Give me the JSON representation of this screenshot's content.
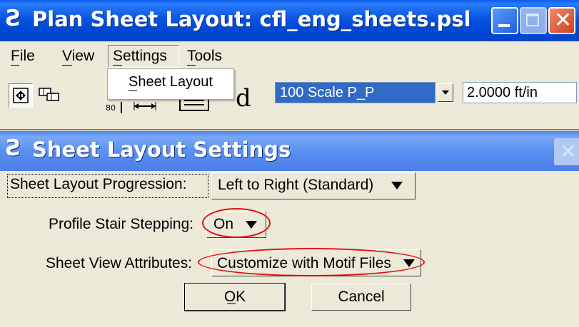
{
  "window1": {
    "title": "Plan Sheet Layout: cfl_eng_sheets.psl",
    "menu": [
      {
        "label": "File"
      },
      {
        "label": "View"
      },
      {
        "label": "Settings"
      },
      {
        "label": "Tools"
      }
    ],
    "settings_dropdown": {
      "item": "Sheet Layout"
    },
    "toolbar": {
      "scale_value": "100 Scale P_P",
      "ft_per_in": "2.0000 ft/in"
    }
  },
  "window2": {
    "title": "Sheet Layout Settings",
    "fields": {
      "progression_label": "Sheet Layout Progression:",
      "progression_value": "Left to Right (Standard)",
      "stair_label": "Profile Stair Stepping:",
      "stair_value": "On",
      "attributes_label": "Sheet View Attributes:",
      "attributes_value": "Customize with Motif Files"
    },
    "buttons": {
      "ok": "OK",
      "cancel": "Cancel"
    }
  },
  "colors": {
    "titlebar_active": "#0054e3",
    "titlebar_inactive": "#7aa8f8",
    "face": "#ece9d8",
    "selection": "#316ac5",
    "highlight_ellipse": "#e01010"
  }
}
